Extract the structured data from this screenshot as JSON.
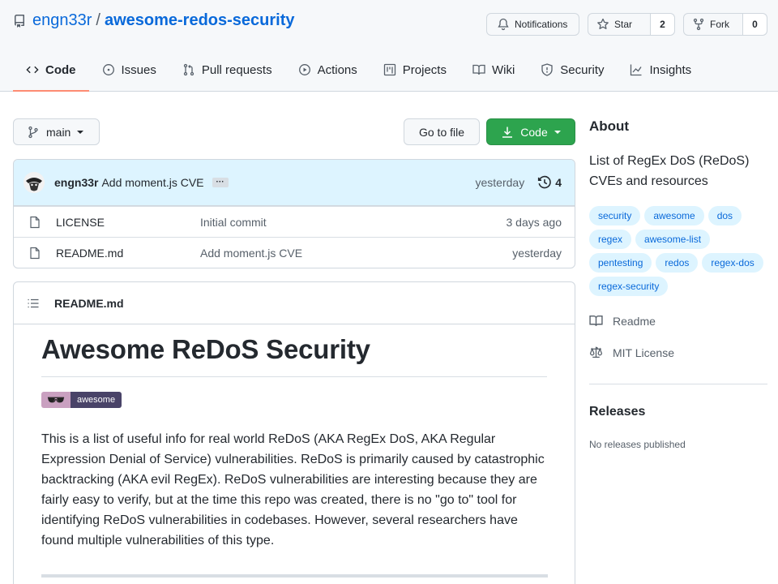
{
  "repo": {
    "owner": "engn33r",
    "separator": "/",
    "name": "awesome-redos-security"
  },
  "header_buttons": {
    "notifications": "Notifications",
    "star": "Star",
    "star_count": "2",
    "fork": "Fork",
    "fork_count": "0"
  },
  "tabs": [
    {
      "label": "Code",
      "icon": "code-icon",
      "active": true
    },
    {
      "label": "Issues",
      "icon": "issue-icon"
    },
    {
      "label": "Pull requests",
      "icon": "pull-request-icon"
    },
    {
      "label": "Actions",
      "icon": "play-icon"
    },
    {
      "label": "Projects",
      "icon": "project-icon"
    },
    {
      "label": "Wiki",
      "icon": "book-icon"
    },
    {
      "label": "Security",
      "icon": "shield-icon"
    },
    {
      "label": "Insights",
      "icon": "graph-icon"
    }
  ],
  "toolbar": {
    "branch": "main",
    "go_to_file": "Go to file",
    "code": "Code"
  },
  "latest_commit": {
    "author": "engn33r",
    "message": "Add moment.js CVE",
    "ellipsis": "···",
    "time": "yesterday",
    "commit_count": "4"
  },
  "files": [
    {
      "name": "LICENSE",
      "message": "Initial commit",
      "time": "3 days ago"
    },
    {
      "name": "README.md",
      "message": "Add moment.js CVE",
      "time": "yesterday"
    }
  ],
  "readme": {
    "filename": "README.md",
    "title": "Awesome ReDoS Security",
    "badge_text": "awesome",
    "paragraph": "This is a list of useful info for real world ReDoS (AKA RegEx DoS, AKA Regular Expression Denial of Service) vulnerabilities. ReDoS is primarily caused by catastrophic backtracking (AKA evil RegEx). ReDoS vulnerabilities are interesting because they are fairly easy to verify, but at the time this repo was created, there is no \"go to\" tool for identifying ReDoS vulnerabilities in codebases. However, several researchers have found multiple vulnerabilities of this type."
  },
  "about": {
    "heading": "About",
    "description": "List of RegEx DoS (ReDoS) CVEs and resources",
    "topics": [
      "security",
      "awesome",
      "dos",
      "regex",
      "awesome-list",
      "pentesting",
      "redos",
      "regex-dos",
      "regex-security"
    ],
    "readme_link": "Readme",
    "license_link": "MIT License"
  },
  "releases": {
    "heading": "Releases",
    "empty": "No releases published"
  },
  "colors": {
    "accent": "#0969da",
    "primary_button": "#2da44e",
    "tab_underline": "#fd8c73",
    "commit_bar": "#ddf4ff"
  }
}
